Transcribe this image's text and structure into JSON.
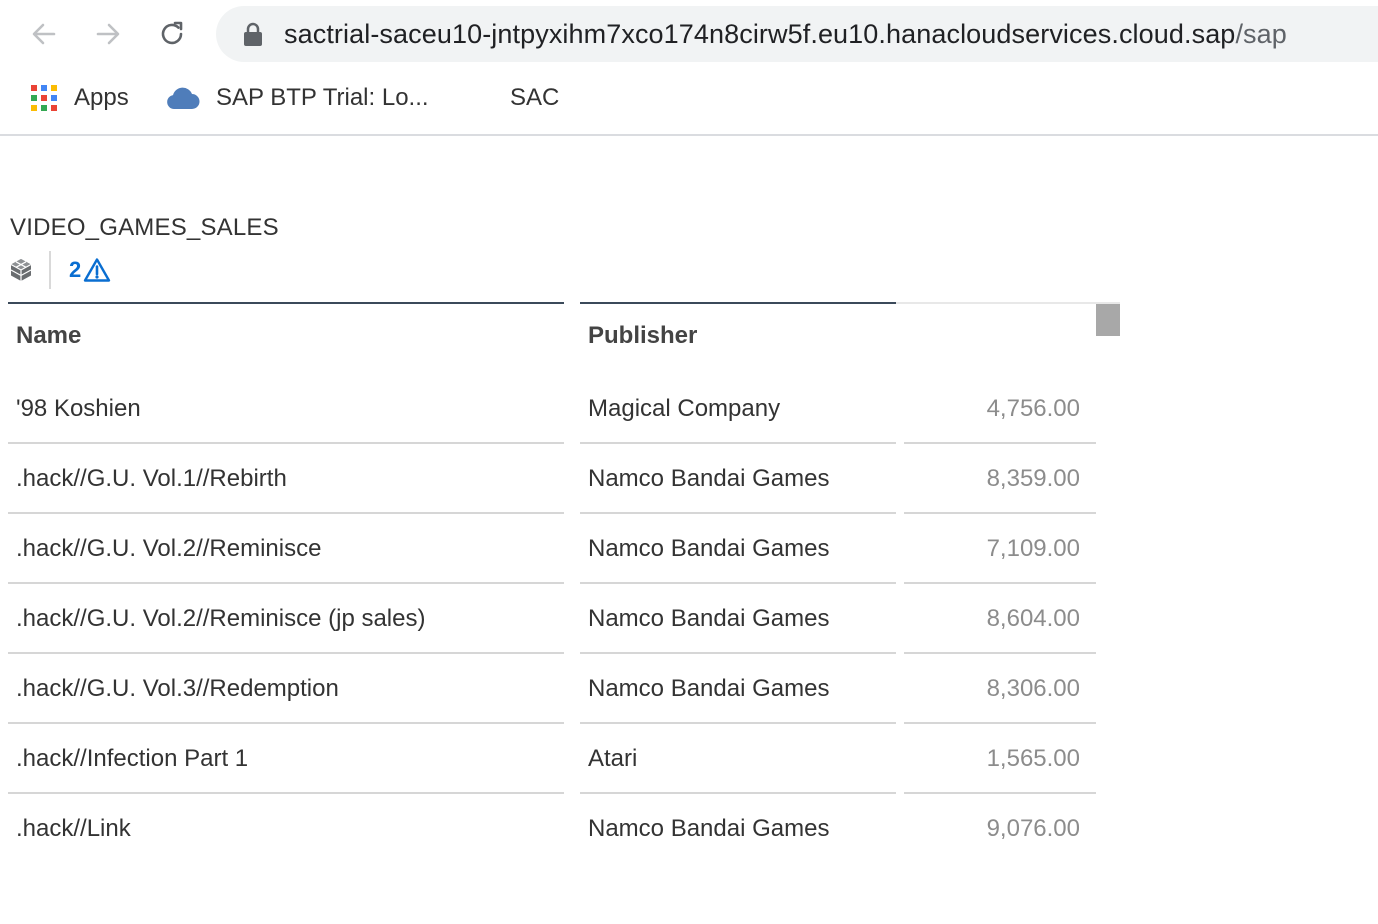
{
  "browser": {
    "url_main": "sactrial-saceu10-jntpyxihm7xco174n8cirw5f.eu10.hanacloudservices.cloud.sap",
    "url_rest": "/sap"
  },
  "bookmarks": [
    {
      "label": "Apps",
      "icon": "apps-grid-icon"
    },
    {
      "label": "SAP BTP Trial: Lo...",
      "icon": "cloud-icon"
    },
    {
      "label": "SAC",
      "icon": ""
    }
  ],
  "table": {
    "title": "VIDEO_GAMES_SALES",
    "warning_count": "2",
    "headers": {
      "name": "Name",
      "publisher": "Publisher",
      "value": ""
    },
    "rows": [
      {
        "name": "'98 Koshien",
        "publisher": "Magical Company",
        "value": "4,756.00"
      },
      {
        "name": ".hack//G.U. Vol.1//Rebirth",
        "publisher": "Namco Bandai Games",
        "value": "8,359.00"
      },
      {
        "name": ".hack//G.U. Vol.2//Reminisce",
        "publisher": "Namco Bandai Games",
        "value": "7,109.00"
      },
      {
        "name": ".hack//G.U. Vol.2//Reminisce (jp sales)",
        "publisher": "Namco Bandai Games",
        "value": "8,604.00"
      },
      {
        "name": ".hack//G.U. Vol.3//Redemption",
        "publisher": "Namco Bandai Games",
        "value": "8,306.00"
      },
      {
        "name": ".hack//Infection Part 1",
        "publisher": "Atari",
        "value": "1,565.00"
      },
      {
        "name": ".hack//Link",
        "publisher": "Namco Bandai Games",
        "value": "9,076.00"
      }
    ]
  },
  "colors": {
    "link_blue": "#0a6ed1",
    "value_gray": "#8c8c8c",
    "header_line": "#3b4a5a"
  }
}
